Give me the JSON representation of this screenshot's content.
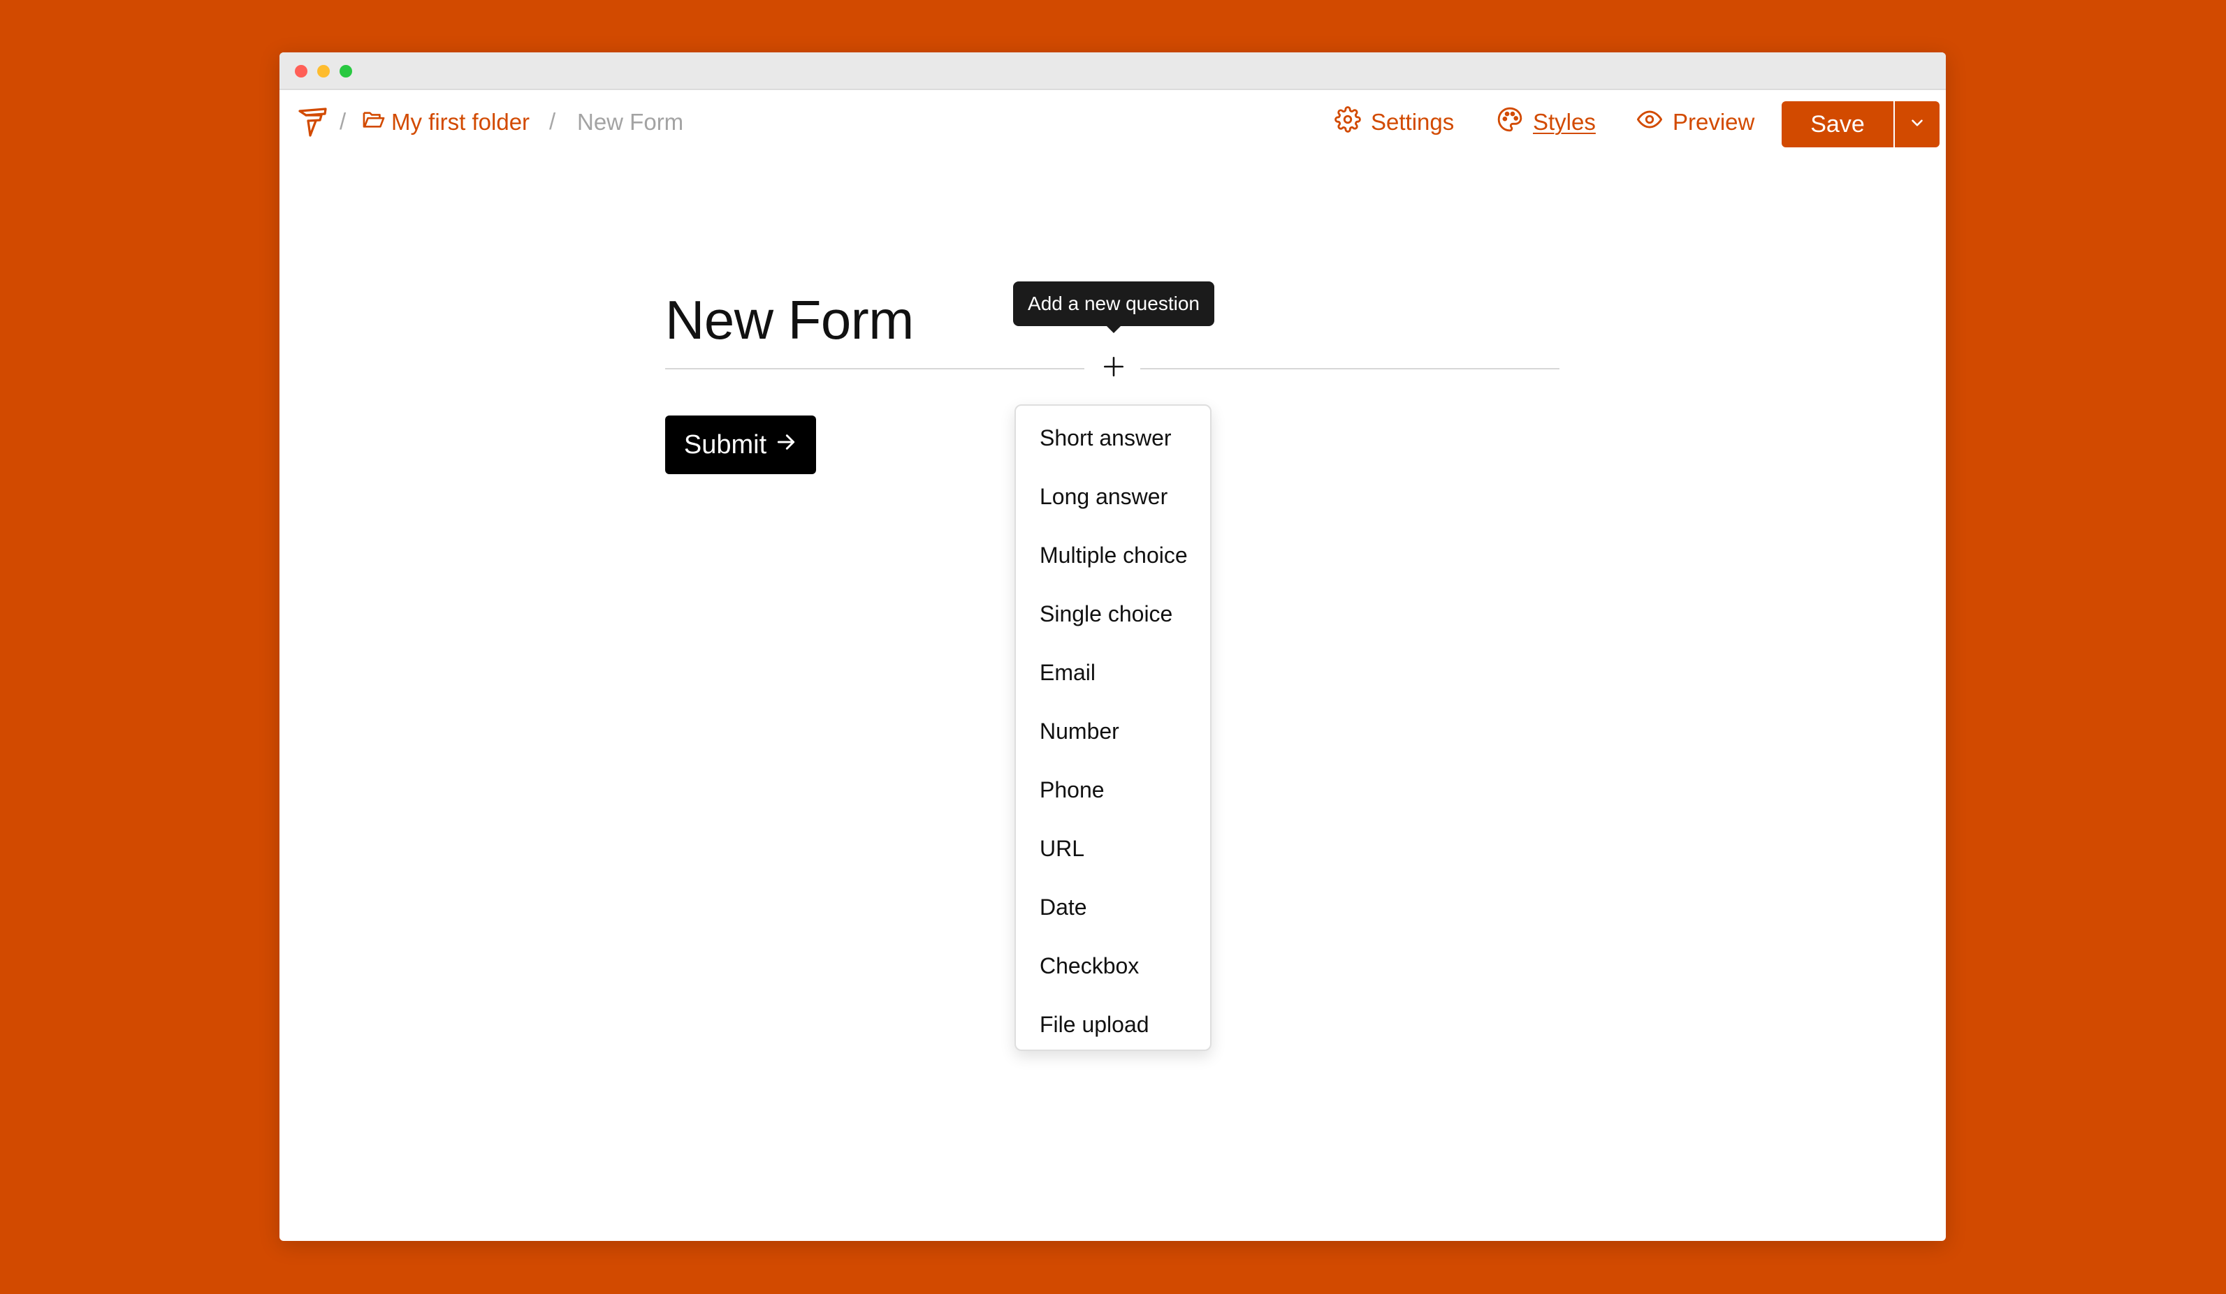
{
  "breadcrumb": {
    "separator": "/",
    "folder_label": "My first folder",
    "current_label": "New Form"
  },
  "toolbar": {
    "settings_label": "Settings",
    "styles_label": "Styles",
    "preview_label": "Preview",
    "save_label": "Save"
  },
  "form": {
    "title": "New Form",
    "submit_label": "Submit",
    "add_tooltip": "Add a new question"
  },
  "question_menu": {
    "items": [
      {
        "label": "Short answer"
      },
      {
        "label": "Long answer"
      },
      {
        "label": "Multiple choice"
      },
      {
        "label": "Single choice"
      },
      {
        "label": "Email"
      },
      {
        "label": "Number"
      },
      {
        "label": "Phone"
      },
      {
        "label": "URL"
      },
      {
        "label": "Date"
      },
      {
        "label": "Checkbox"
      },
      {
        "label": "File upload"
      }
    ]
  },
  "colors": {
    "accent": "#d24a00",
    "background": "#d24a00",
    "muted_text": "#a3a3a3"
  },
  "icons": {
    "logo": "brand-logo-icon",
    "folder": "folder-open-icon",
    "settings": "gear-icon",
    "styles": "palette-icon",
    "preview": "eye-icon",
    "dropdown": "chevron-down-icon",
    "add": "plus-icon",
    "submit_arrow": "arrow-right-icon"
  }
}
